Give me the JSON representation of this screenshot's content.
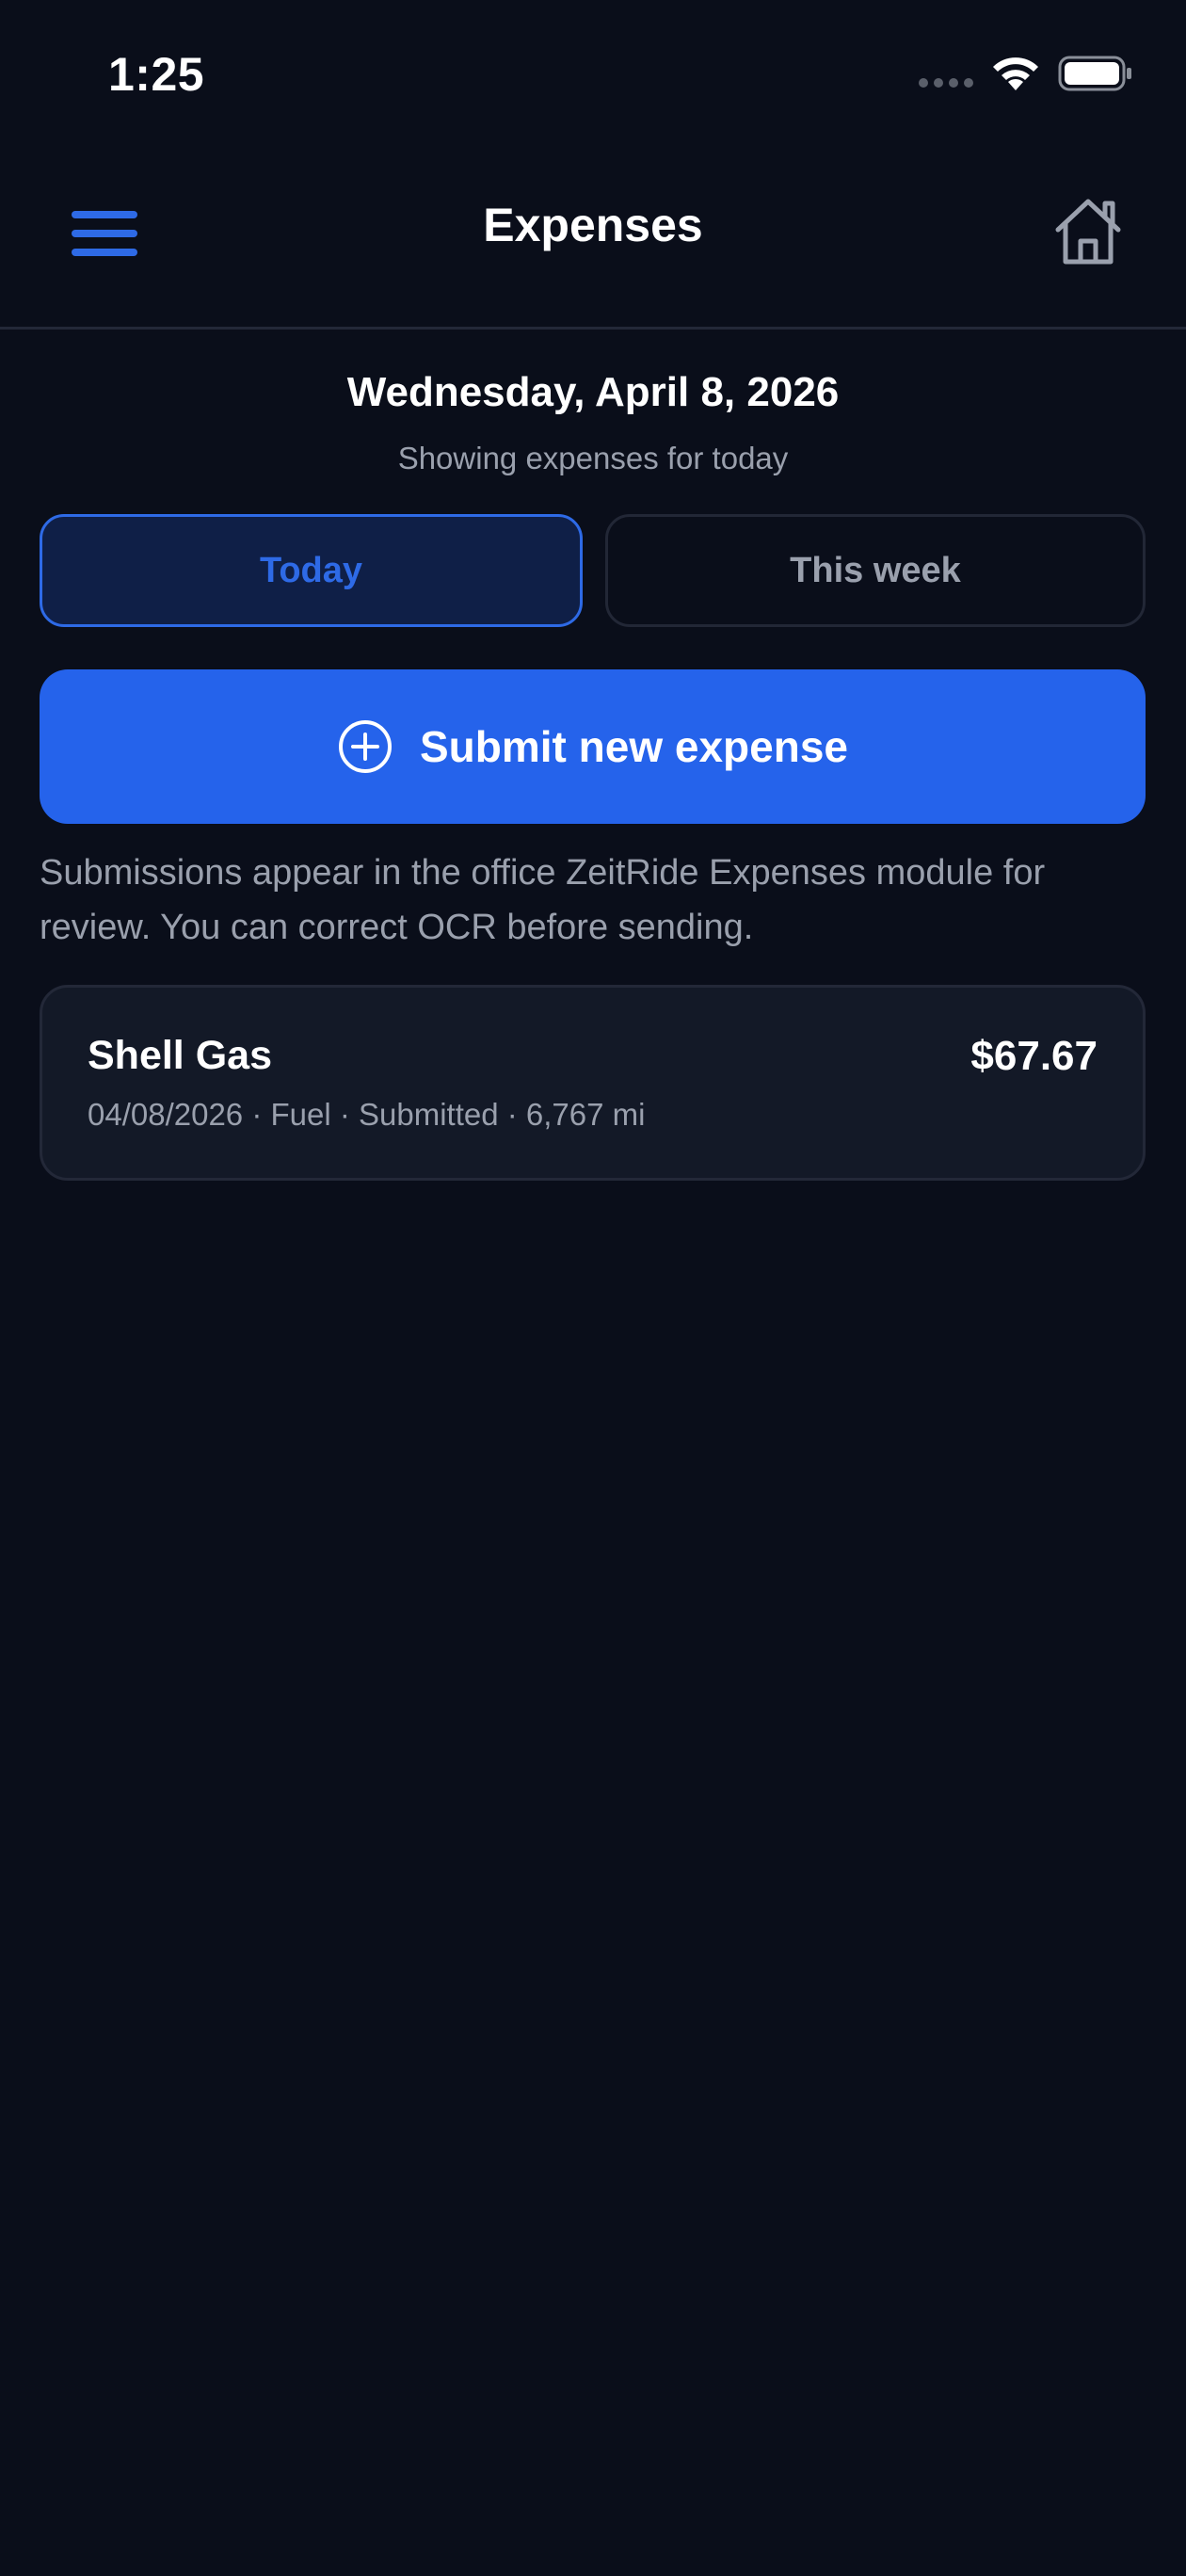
{
  "status_bar": {
    "time": "1:25",
    "wifi_icon": "wifi-icon",
    "battery_icon": "battery-icon"
  },
  "header": {
    "title": "Expenses",
    "menu_icon": "hamburger-menu-icon",
    "home_icon": "home-icon"
  },
  "date_section": {
    "date": "Wednesday, April 8, 2026",
    "subtitle": "Showing expenses for today"
  },
  "tabs": [
    {
      "label": "Today",
      "selected": true
    },
    {
      "label": "This week",
      "selected": false
    }
  ],
  "submit": {
    "label": "Submit new expense",
    "icon": "plus-circle-icon"
  },
  "info_text": "Submissions appear in the office ZeitRide Expenses module for review. You can correct OCR before sending.",
  "expenses": [
    {
      "name": "Shell Gas",
      "amount": "$67.67",
      "meta": "04/08/2026 · Fuel · Submitted · 6,767 mi"
    }
  ],
  "colors": {
    "background": "#0a0e1a",
    "accent": "#2563eb",
    "card": "#131927",
    "muted_text": "#9aa0ad"
  }
}
